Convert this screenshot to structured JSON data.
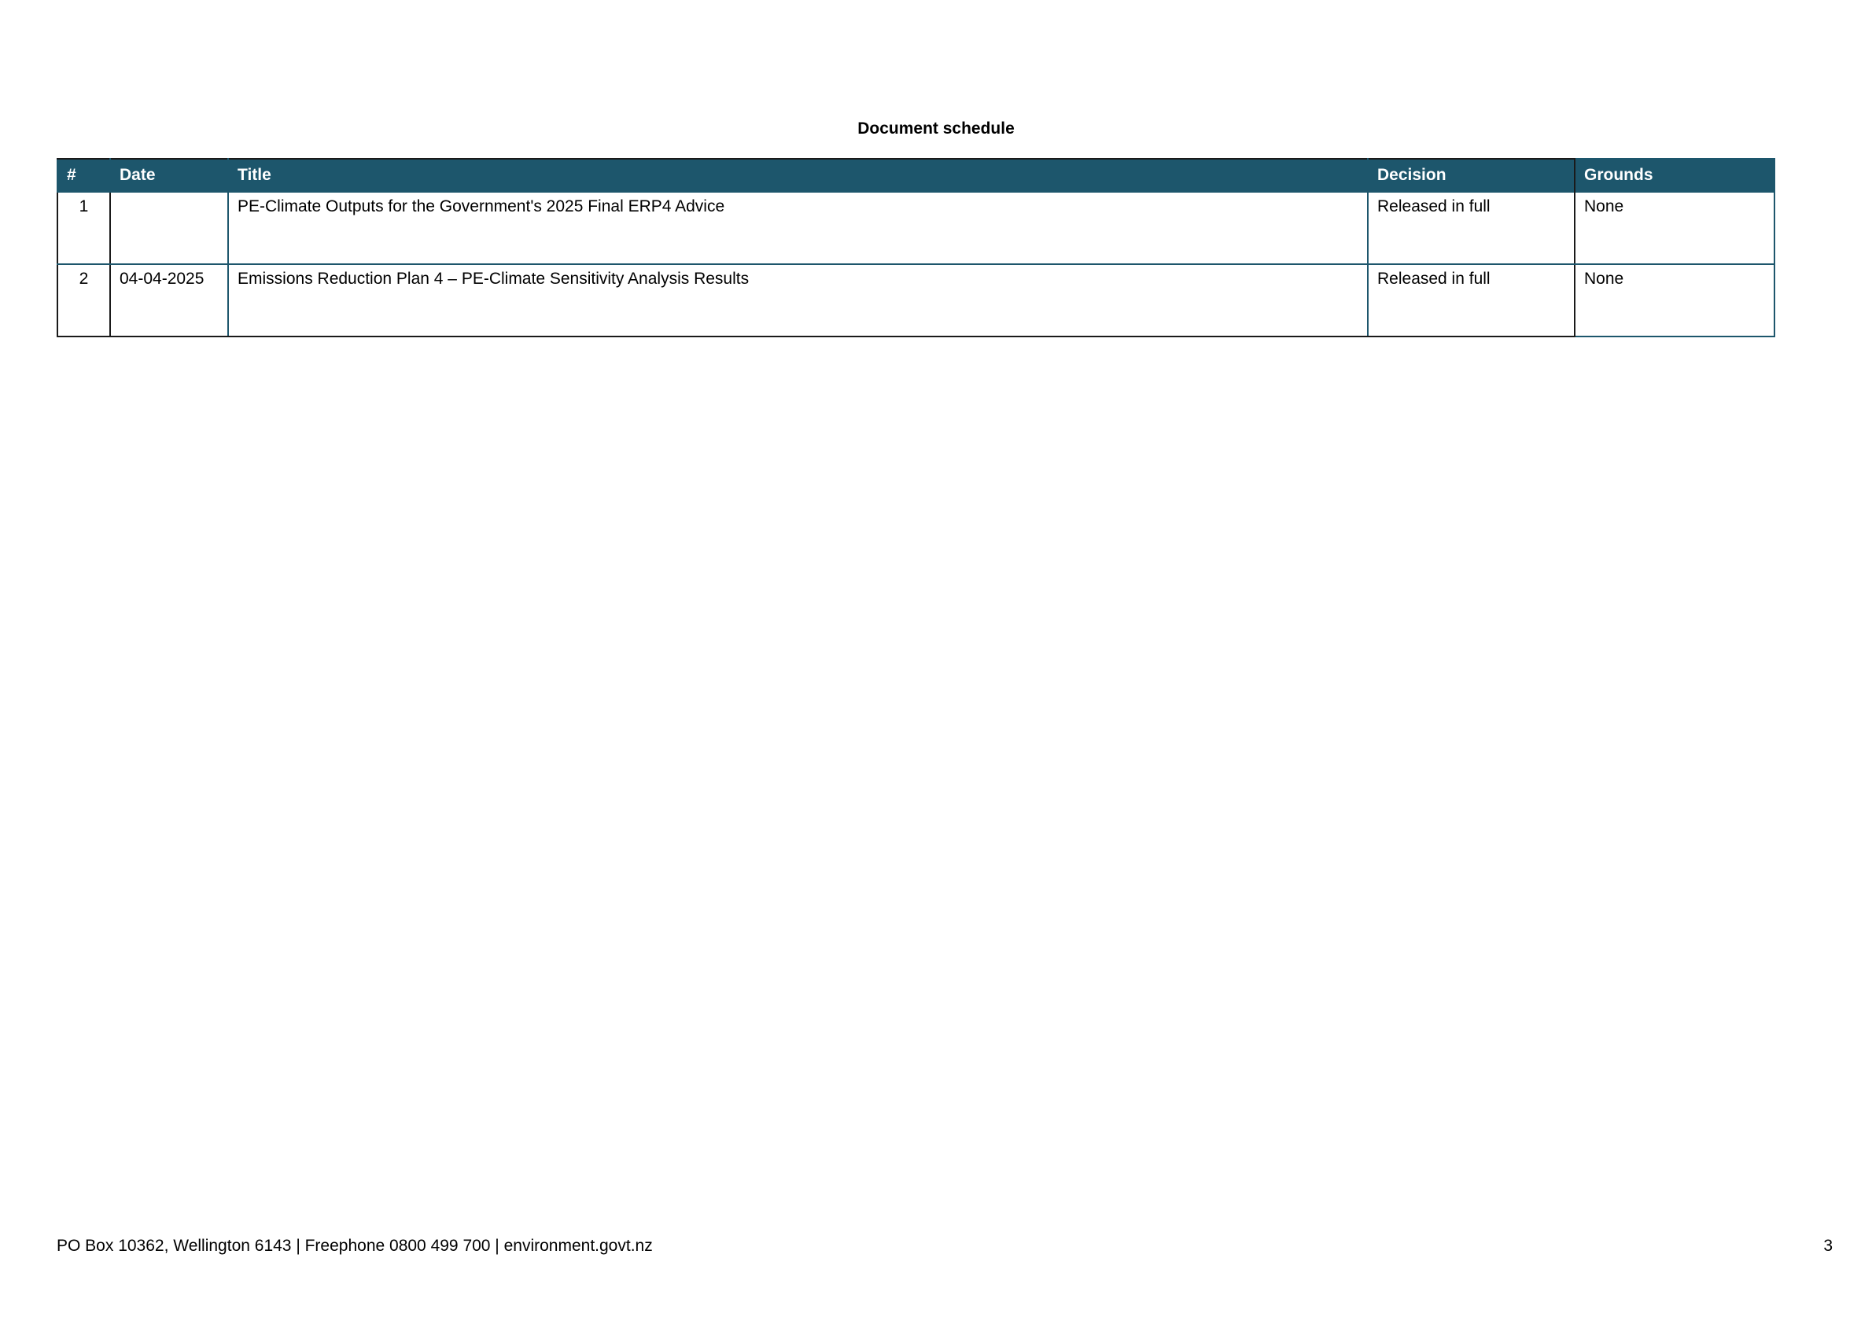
{
  "heading": "Document schedule",
  "table": {
    "headers": {
      "num": "#",
      "date": "Date",
      "title": "Title",
      "decision": "Decision",
      "grounds": "Grounds"
    },
    "rows": [
      {
        "num": "1",
        "date": "",
        "title": "PE-Climate Outputs for the Government's 2025 Final ERP4 Advice",
        "decision": "Released in full",
        "grounds": "None"
      },
      {
        "num": "2",
        "date": "04-04-2025",
        "title": "Emissions Reduction Plan 4 – PE-Climate Sensitivity Analysis Results",
        "decision": "Released in full",
        "grounds": "None"
      }
    ]
  },
  "footer": {
    "contact": "PO Box 10362, Wellington 6143 | Freephone 0800 499 700 | environment.govt.nz",
    "page_number": "3"
  },
  "colors": {
    "header_bg": "#1d566c",
    "header_text": "#ffffff",
    "border_dark": "#1a1a1a"
  }
}
